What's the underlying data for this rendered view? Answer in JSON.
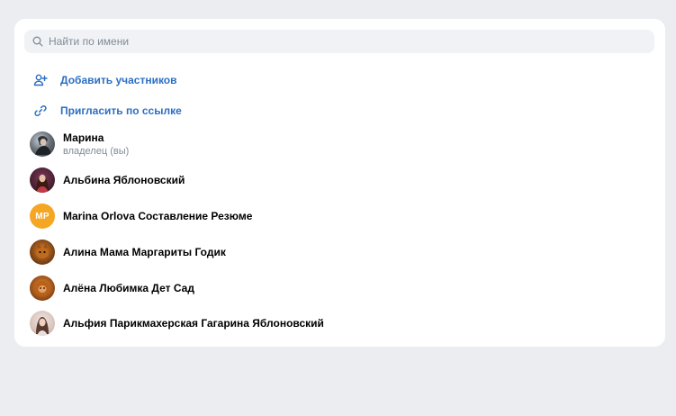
{
  "search": {
    "placeholder": "Найти по имени",
    "value": ""
  },
  "actions": [
    {
      "label": "Добавить участников",
      "icon": "add-user-icon"
    },
    {
      "label": "Пригласить по ссылке",
      "icon": "link-icon"
    }
  ],
  "members": [
    {
      "name": "Марина",
      "role": "владелец (вы)",
      "avatar": "photo"
    },
    {
      "name": "Альбина Яблоновский",
      "role": "",
      "avatar": "photo"
    },
    {
      "name": "Marina Orlova Составление Резюме",
      "role": "",
      "avatar": "initials",
      "initials": "MP",
      "avatar_color": "#f5a623"
    },
    {
      "name": "Алина Мама Маргариты Годик",
      "role": "",
      "avatar": "photo"
    },
    {
      "name": "Алёна Любимка Дет Сад",
      "role": "",
      "avatar": "photo"
    },
    {
      "name": "Альфия Парикмахерская Гагарина Яблоновский",
      "role": "",
      "avatar": "photo"
    }
  ],
  "colors": {
    "accent": "#2b6fc2",
    "background": "#ebedf0",
    "card": "#ffffff",
    "search_bg": "#f0f2f5",
    "secondary_text": "#818c99"
  }
}
